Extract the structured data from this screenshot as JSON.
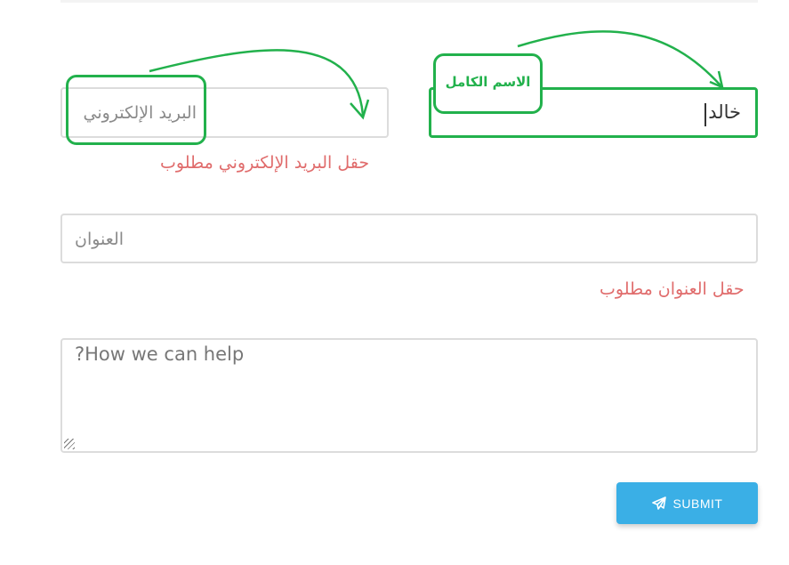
{
  "form": {
    "email_placeholder": "البريد الإلكتروني",
    "email_error": "حقل البريد الإلكتروني مطلوب",
    "name_value": "خالد",
    "address_placeholder": "العنوان",
    "address_error": "حقل العنوان مطلوب",
    "message_placeholder": "?How we can help",
    "submit_label": "SUBMIT"
  },
  "annotations": {
    "name_label": "الاسم الكامل"
  },
  "colors": {
    "annotation_green": "#22b14c",
    "error_red": "#e06c6c",
    "submit_blue": "#3aafe6"
  },
  "icons": {
    "submit": "paper-plane-icon"
  }
}
